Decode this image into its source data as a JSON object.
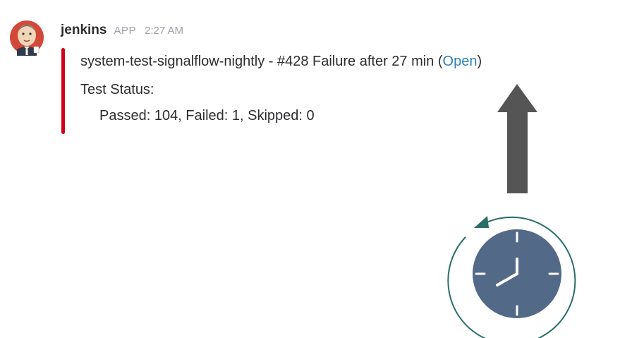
{
  "message": {
    "sender": "jenkins",
    "app_badge": "APP",
    "timestamp": "2:27 AM",
    "title_text": "system-test-signalflow-nightly - #428 Failure after 27 min (",
    "link_label": "Open",
    "title_close": ")",
    "status_heading": "Test Status:",
    "status_detail": "Passed: 104, Failed: 1, Skipped: 0"
  },
  "icons": {
    "avatar": "jenkins-butler-avatar",
    "arrow": "up-arrow-icon",
    "clock": "clock-icon",
    "cycle": "circular-arrow-icon"
  },
  "colors": {
    "failure_bar": "#d0021b",
    "link": "#2a80b9",
    "arrow": "#555555",
    "clock_face": "#526a87",
    "cycle_ring": "#2b6e68"
  }
}
